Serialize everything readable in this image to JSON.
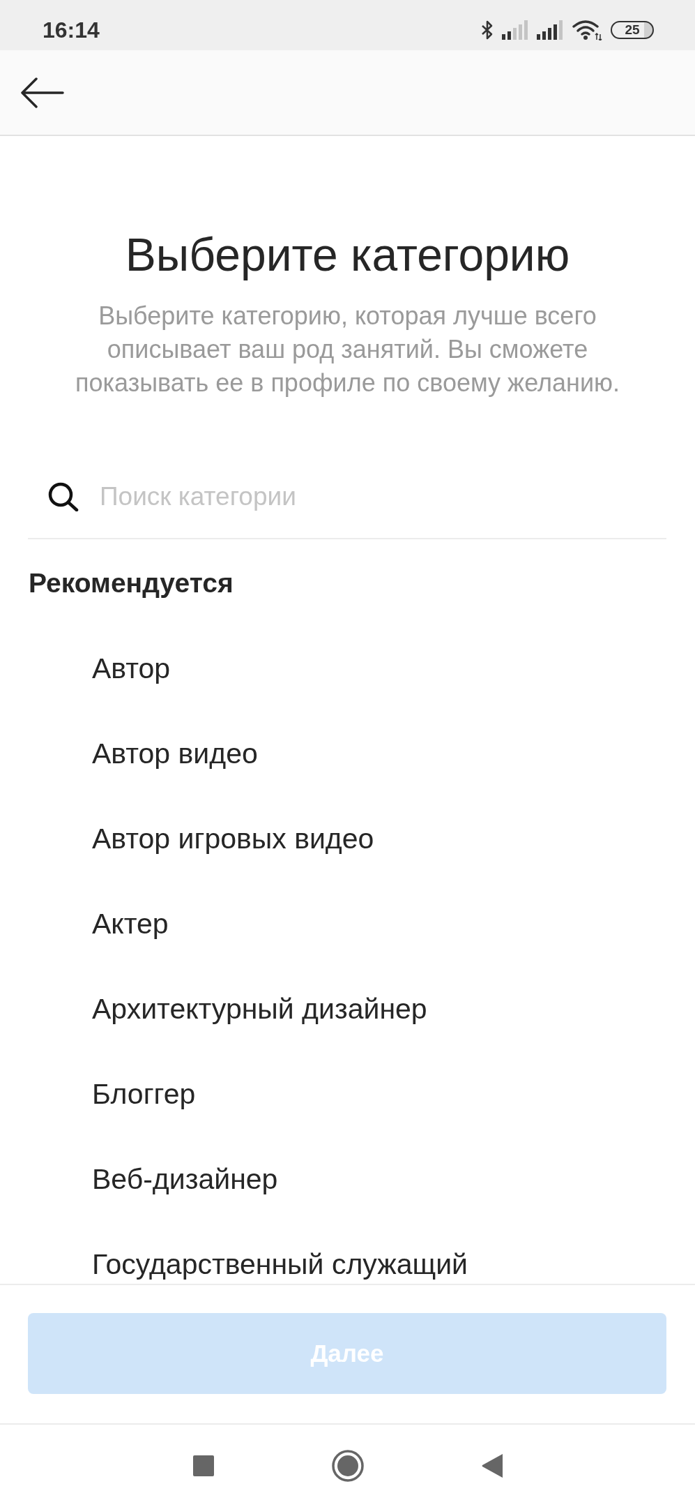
{
  "status_bar": {
    "time": "16:14",
    "battery": "25"
  },
  "header": {
    "title": "Выберите категорию",
    "description": "Выберите категорию, которая лучше всего описывает ваш род занятий. Вы сможете показывать ее в профиле по своему желанию."
  },
  "search": {
    "placeholder": "Поиск категории"
  },
  "recommended": {
    "heading": "Рекомендуется",
    "categories": [
      {
        "label": "Автор",
        "selected": false
      },
      {
        "label": "Автор видео",
        "selected": false
      },
      {
        "label": "Автор игровых видео",
        "selected": false
      },
      {
        "label": "Актер",
        "selected": false
      },
      {
        "label": "Архитектурный дизайнер",
        "selected": false
      },
      {
        "label": "Блоггер",
        "selected": false
      },
      {
        "label": "Веб-дизайнер",
        "selected": false
      },
      {
        "label": "Государственный служащий",
        "selected": false
      }
    ]
  },
  "next_button": {
    "label": "Далее",
    "disabled": true
  }
}
